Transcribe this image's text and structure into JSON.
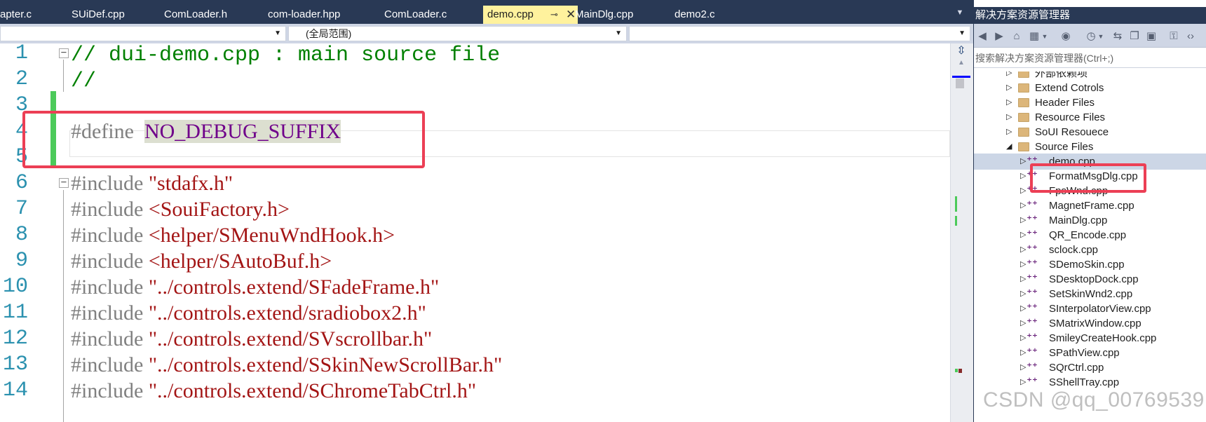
{
  "tabs": [
    {
      "label": "apter.c"
    },
    {
      "label": "SUiDef.cpp"
    },
    {
      "label": "ComLoader.h"
    },
    {
      "label": "com-loader.hpp"
    },
    {
      "label": "ComLoader.c"
    },
    {
      "label": "demo.cpp",
      "active": true
    },
    {
      "label": "MainDlg.cpp"
    },
    {
      "label": "demo2.c"
    }
  ],
  "tab_icons": {
    "pin": "pin-icon",
    "close": "close-icon",
    "overflow": "chevron-down-icon"
  },
  "nav_bar": {
    "project_combo": "",
    "scope_combo": "(全局范围)",
    "member_combo": ""
  },
  "code": {
    "lines": [
      {
        "number": "1",
        "tokens": [
          {
            "kind": "comment",
            "text": "// dui-demo.cpp : main source file"
          }
        ]
      },
      {
        "number": "2",
        "tokens": [
          {
            "kind": "comment",
            "text": "//"
          }
        ]
      },
      {
        "number": "3",
        "tokens": []
      },
      {
        "number": "4",
        "tokens": [
          {
            "kind": "pp",
            "text": "#define  "
          },
          {
            "kind": "macro",
            "text": "NO_DEBUG_SUFFIX"
          }
        ]
      },
      {
        "number": "5",
        "tokens": []
      },
      {
        "number": "6",
        "tokens": [
          {
            "kind": "pp",
            "text": "#include "
          },
          {
            "kind": "string",
            "text": "\"stdafx.h\""
          }
        ]
      },
      {
        "number": "7",
        "tokens": [
          {
            "kind": "pp",
            "text": "#include "
          },
          {
            "kind": "string",
            "text": "<SouiFactory.h>"
          }
        ]
      },
      {
        "number": "8",
        "tokens": [
          {
            "kind": "pp",
            "text": "#include "
          },
          {
            "kind": "string",
            "text": "<helper/SMenuWndHook.h>"
          }
        ]
      },
      {
        "number": "9",
        "tokens": [
          {
            "kind": "pp",
            "text": "#include "
          },
          {
            "kind": "string",
            "text": "<helper/SAutoBuf.h>"
          }
        ]
      },
      {
        "number": "10",
        "tokens": [
          {
            "kind": "pp",
            "text": "#include "
          },
          {
            "kind": "string",
            "text": "\"../controls.extend/SFadeFrame.h\""
          }
        ]
      },
      {
        "number": "11",
        "tokens": [
          {
            "kind": "pp",
            "text": "#include "
          },
          {
            "kind": "string",
            "text": "\"../controls.extend/sradiobox2.h\""
          }
        ]
      },
      {
        "number": "12",
        "tokens": [
          {
            "kind": "pp",
            "text": "#include "
          },
          {
            "kind": "string",
            "text": "\"../controls.extend/SVscrollbar.h\""
          }
        ]
      },
      {
        "number": "13",
        "tokens": [
          {
            "kind": "pp",
            "text": "#include "
          },
          {
            "kind": "string",
            "text": "\"../controls.extend/SSkinNewScrollBar.h\""
          }
        ]
      },
      {
        "number": "14",
        "tokens": [
          {
            "kind": "pp",
            "text": "#include "
          },
          {
            "kind": "string",
            "text": "\"../controls.extend/SChromeTabCtrl.h\""
          }
        ]
      }
    ]
  },
  "solution_explorer": {
    "title": "解决方案资源管理器",
    "search_placeholder": "搜索解决方案资源管理器(Ctrl+;)",
    "toolbar_icons": [
      "back-icon",
      "forward-icon",
      "home-icon",
      "switch-view-icon",
      "dropdown-icon",
      "sync-icon",
      "pending-changes-icon",
      "dropdown-icon",
      "refresh-icon",
      "collapse-all-icon",
      "show-all-files-icon",
      "properties-icon",
      "code-view-icon"
    ],
    "items": [
      {
        "label": "外部依赖项",
        "type": "folder",
        "expanded": false
      },
      {
        "label": "Extend Cotrols",
        "type": "folder",
        "expanded": false
      },
      {
        "label": "Header Files",
        "type": "folder",
        "expanded": false
      },
      {
        "label": "Resource Files",
        "type": "folder",
        "expanded": false
      },
      {
        "label": "SoUI Resouece",
        "type": "folder",
        "expanded": false
      },
      {
        "label": "Source Files",
        "type": "folder",
        "expanded": true
      },
      {
        "label": "demo.cpp",
        "type": "cpp",
        "selected": true
      },
      {
        "label": "FormatMsgDlg.cpp",
        "type": "cpp"
      },
      {
        "label": "FpsWnd.cpp",
        "type": "cpp"
      },
      {
        "label": "MagnetFrame.cpp",
        "type": "cpp"
      },
      {
        "label": "MainDlg.cpp",
        "type": "cpp"
      },
      {
        "label": "QR_Encode.cpp",
        "type": "cpp"
      },
      {
        "label": "sclock.cpp",
        "type": "cpp"
      },
      {
        "label": "SDemoSkin.cpp",
        "type": "cpp"
      },
      {
        "label": "SDesktopDock.cpp",
        "type": "cpp"
      },
      {
        "label": "SetSkinWnd2.cpp",
        "type": "cpp"
      },
      {
        "label": "SInterpolatorView.cpp",
        "type": "cpp"
      },
      {
        "label": "SMatrixWindow.cpp",
        "type": "cpp"
      },
      {
        "label": "SmileyCreateHook.cpp",
        "type": "cpp"
      },
      {
        "label": "SPathView.cpp",
        "type": "cpp"
      },
      {
        "label": "SQrCtrl.cpp",
        "type": "cpp"
      },
      {
        "label": "SShellTray.cpp",
        "type": "cpp"
      }
    ]
  },
  "watermark": "CSDN @qq_00769539",
  "colors": {
    "chrome": "#293955",
    "active_tab": "#fff29d",
    "comment": "#008000",
    "preprocessor": "#808080",
    "macro": "#6f008a",
    "string": "#a31515",
    "line_number": "#2b91af",
    "annotation_box": "#ec3f55",
    "change_marker": "#4cca5a"
  }
}
